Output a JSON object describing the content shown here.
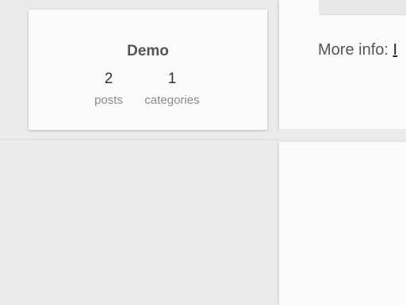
{
  "profile": {
    "title": "Demo",
    "stats": {
      "posts_count": "2",
      "posts_label": "posts",
      "categories_count": "1",
      "categories_label": "categories"
    }
  },
  "info": {
    "more_info_label": "More info:",
    "link_text": "I"
  }
}
